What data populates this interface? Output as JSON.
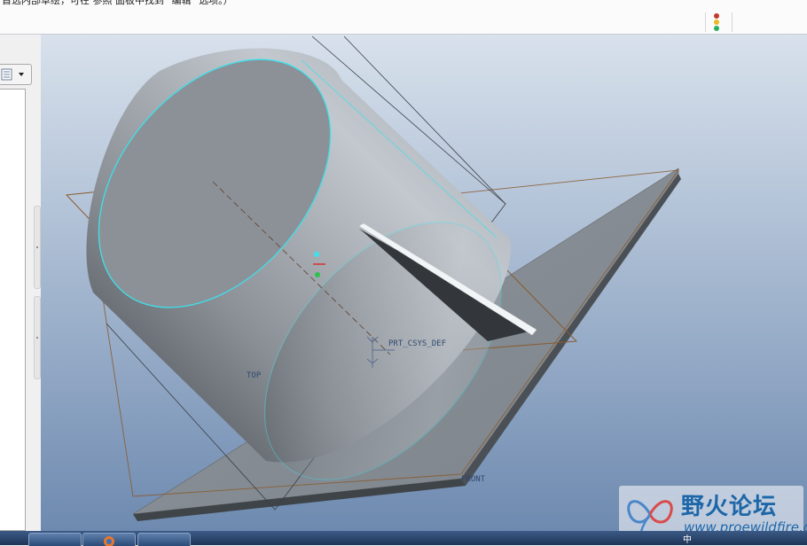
{
  "message_bar": {
    "text": "首选内部草绘，可在 参照 面板中找到 \"编辑\" 选项。）"
  },
  "status_light": {
    "colors": [
      "#c0392b",
      "#e8b923",
      "#27ae60"
    ]
  },
  "model_tree": {
    "toggle_icon": "tree-list-icon",
    "dropdown_icon": "chevron-down-icon"
  },
  "viewport": {
    "datum_labels": {
      "top": "TOP",
      "front": "FRONT",
      "csys": "PRT_CSYS_DEF"
    },
    "colors": {
      "edge_highlight": "#3ee0ec",
      "datum_plane": "#8a5a2e"
    }
  },
  "watermark": {
    "title": "野火论坛",
    "url": "www.proewildfire.cn"
  },
  "taskbar": {
    "tray_text": "中"
  }
}
